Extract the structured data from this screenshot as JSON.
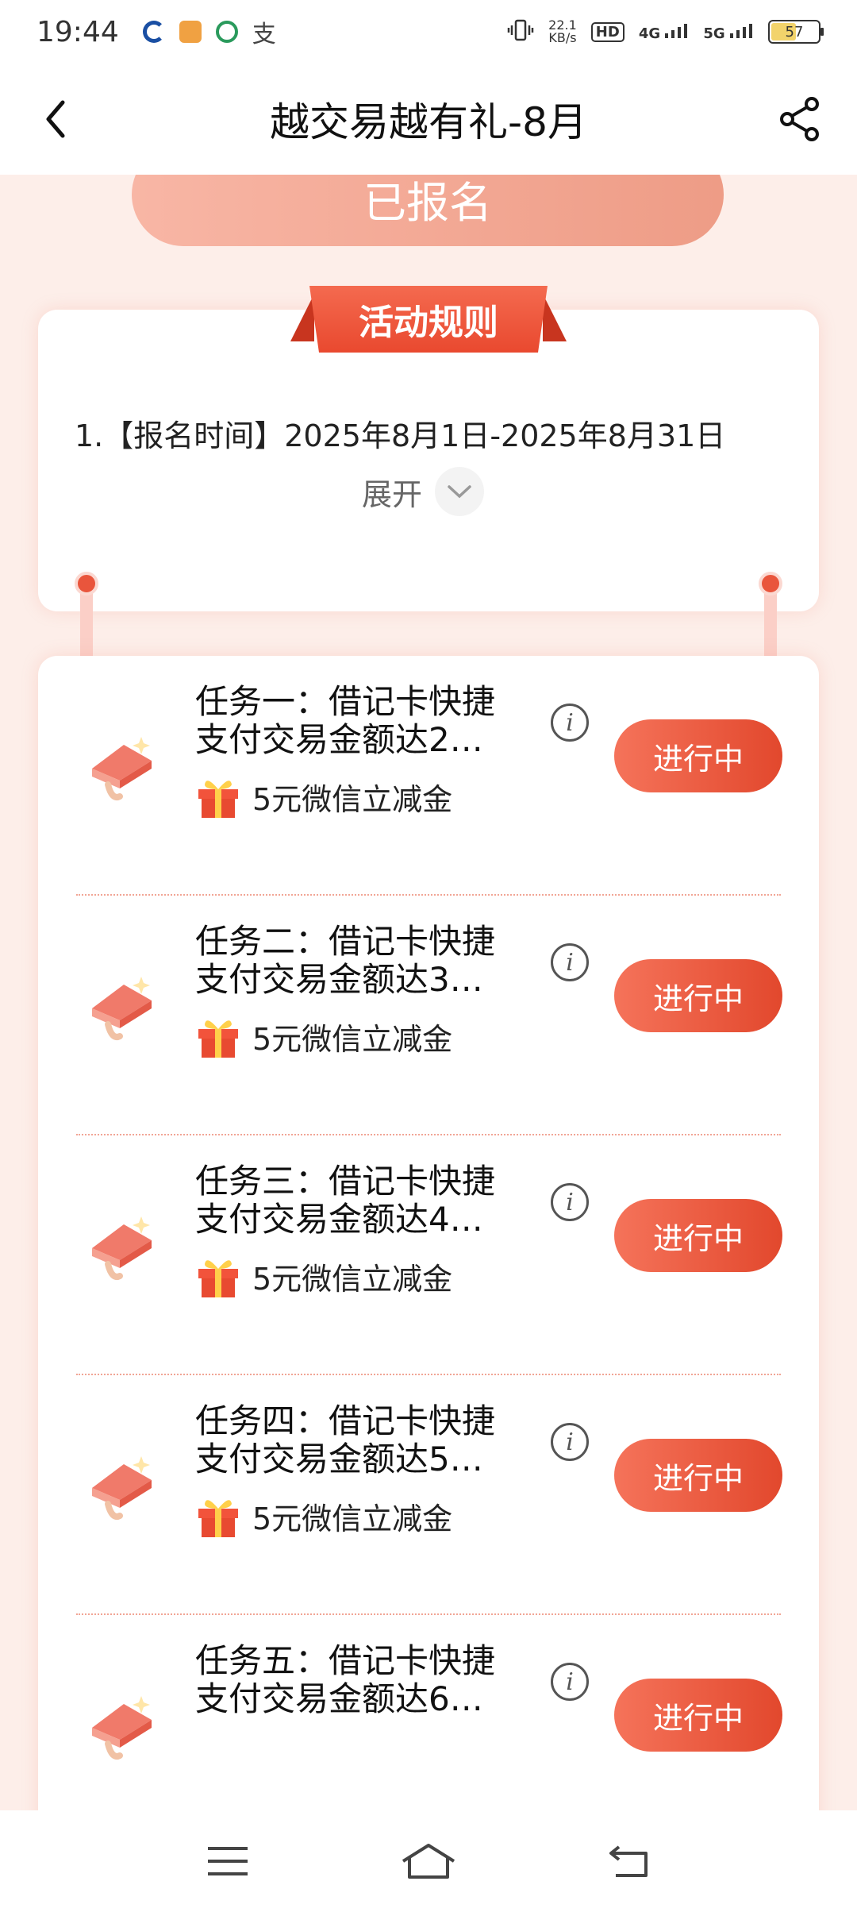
{
  "status_bar": {
    "time": "19:44",
    "net_speed": "22.1",
    "net_unit": "KB/s",
    "hd_label": "HD",
    "signal1": "4G",
    "signal2": "5G",
    "battery": "57",
    "app_icons": [
      "bank-app-icon",
      "game-app-icon",
      "green-app-icon",
      "alipay-icon"
    ]
  },
  "header": {
    "title": "越交易越有礼-8月"
  },
  "signup": {
    "label": "已报名"
  },
  "rules": {
    "banner": "活动规则",
    "line1": "1.【报名时间】2025年8月1日-2025年8月31日",
    "expand_label": "展开"
  },
  "tasks": [
    {
      "name_line1": "任务一：借记卡快捷",
      "name_line2": "支付交易金额达2…",
      "reward": "5元微信立减金",
      "status": "进行中"
    },
    {
      "name_line1": "任务二：借记卡快捷",
      "name_line2": "支付交易金额达3…",
      "reward": "5元微信立减金",
      "status": "进行中"
    },
    {
      "name_line1": "任务三：借记卡快捷",
      "name_line2": "支付交易金额达4…",
      "reward": "5元微信立减金",
      "status": "进行中"
    },
    {
      "name_line1": "任务四：借记卡快捷",
      "name_line2": "支付交易金额达5…",
      "reward": "5元微信立减金",
      "status": "进行中"
    },
    {
      "name_line1": "任务五：借记卡快捷",
      "name_line2": "支付交易金额达6…",
      "reward": "",
      "status": "进行中"
    }
  ],
  "colors": {
    "accent": "#e9492f",
    "signed_button": "#f8b6a5",
    "page_bg": "#fdeee9"
  }
}
